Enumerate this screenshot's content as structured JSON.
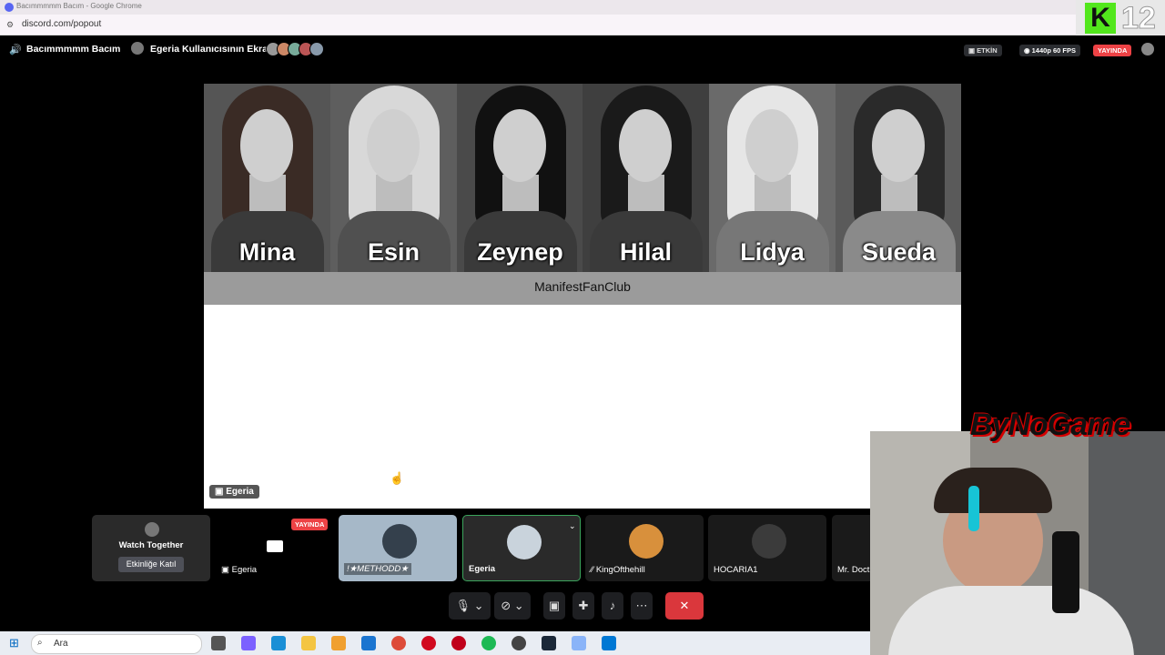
{
  "chrome": {
    "window_title": "Bacımmmmm Bacım - Google Chrome",
    "url": "discord.com/popout"
  },
  "overlay": {
    "logo_letter": "K",
    "channel_number": "12",
    "bynogame": "ByNoGame"
  },
  "header": {
    "channel_name": "Bacımmmmm Bacım",
    "stream_title": "Egeria Kullanıcısının Ekranı",
    "activity_label": "ETKİN",
    "quality_label": "1440p 60 FPS",
    "live_label": "YAYINDA"
  },
  "stage": {
    "members": [
      "Mina",
      "Esin",
      "Zeynep",
      "Hilal",
      "Lidya",
      "Sueda"
    ],
    "club_name": "ManifestFanClub",
    "streamer_label": "Egeria"
  },
  "tiles": {
    "watch_together": "Watch Together",
    "join_activity": "Etkinliğe Katıl",
    "egeria_stream": "Egeria",
    "live_badge": "YAYINDA",
    "method": "!★METHODD★",
    "egeria": "Egeria",
    "kingofthehill": "KingOfthehill",
    "hocaria": "HOCARIA1",
    "mr_doctor": "Mr. Doct"
  },
  "taskbar": {
    "search_label": "Ara"
  },
  "colors": {
    "accent_red": "#da373c",
    "discord_blurple": "#5865f2",
    "live_red": "#ed4245",
    "active_green": "#3ba55c"
  }
}
